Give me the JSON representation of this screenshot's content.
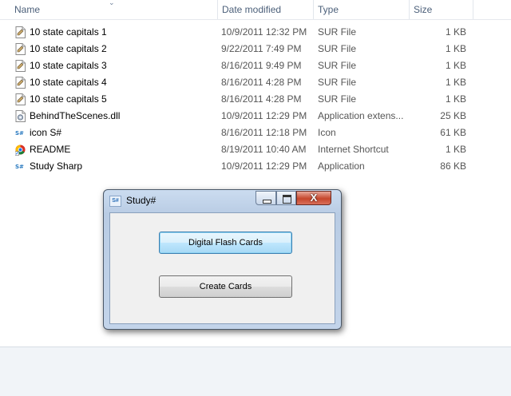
{
  "columns": {
    "name": "Name",
    "date": "Date modified",
    "type": "Type",
    "size": "Size"
  },
  "files": [
    {
      "name": "10 state capitals 1",
      "date": "10/9/2011 12:32 PM",
      "type": "SUR File",
      "size": "1 KB",
      "icon": "sur-file-icon"
    },
    {
      "name": "10 state capitals 2",
      "date": "9/22/2011 7:49 PM",
      "type": "SUR File",
      "size": "1 KB",
      "icon": "sur-file-icon"
    },
    {
      "name": "10 state capitals 3",
      "date": "8/16/2011 9:49 PM",
      "type": "SUR File",
      "size": "1 KB",
      "icon": "sur-file-icon"
    },
    {
      "name": "10 state capitals 4",
      "date": "8/16/2011 4:28 PM",
      "type": "SUR File",
      "size": "1 KB",
      "icon": "sur-file-icon"
    },
    {
      "name": "10 state capitals 5",
      "date": "8/16/2011 4:28 PM",
      "type": "SUR File",
      "size": "1 KB",
      "icon": "sur-file-icon"
    },
    {
      "name": "BehindTheScenes.dll",
      "date": "10/9/2011 12:29 PM",
      "type": "Application extens...",
      "size": "25 KB",
      "icon": "dll-file-icon"
    },
    {
      "name": "icon S#",
      "date": "8/16/2011 12:18 PM",
      "type": "Icon",
      "size": "61 KB",
      "icon": "s-sharp-icon"
    },
    {
      "name": "README",
      "date": "8/19/2011 10:40 AM",
      "type": "Internet Shortcut",
      "size": "1 KB",
      "icon": "chrome-shortcut-icon"
    },
    {
      "name": "Study Sharp",
      "date": "10/9/2011 12:29 PM",
      "type": "Application",
      "size": "86 KB",
      "icon": "s-sharp-icon"
    }
  ],
  "dialog": {
    "title": "Study#",
    "app_icon_text": "S#",
    "buttons": {
      "flash_cards": "Digital Flash Cards",
      "create_cards": "Create Cards"
    },
    "close_glyph": "X"
  },
  "colors": {
    "header_text": "#4c607a",
    "title_bar": "#c3d4ea",
    "close_button": "#c6462c"
  }
}
